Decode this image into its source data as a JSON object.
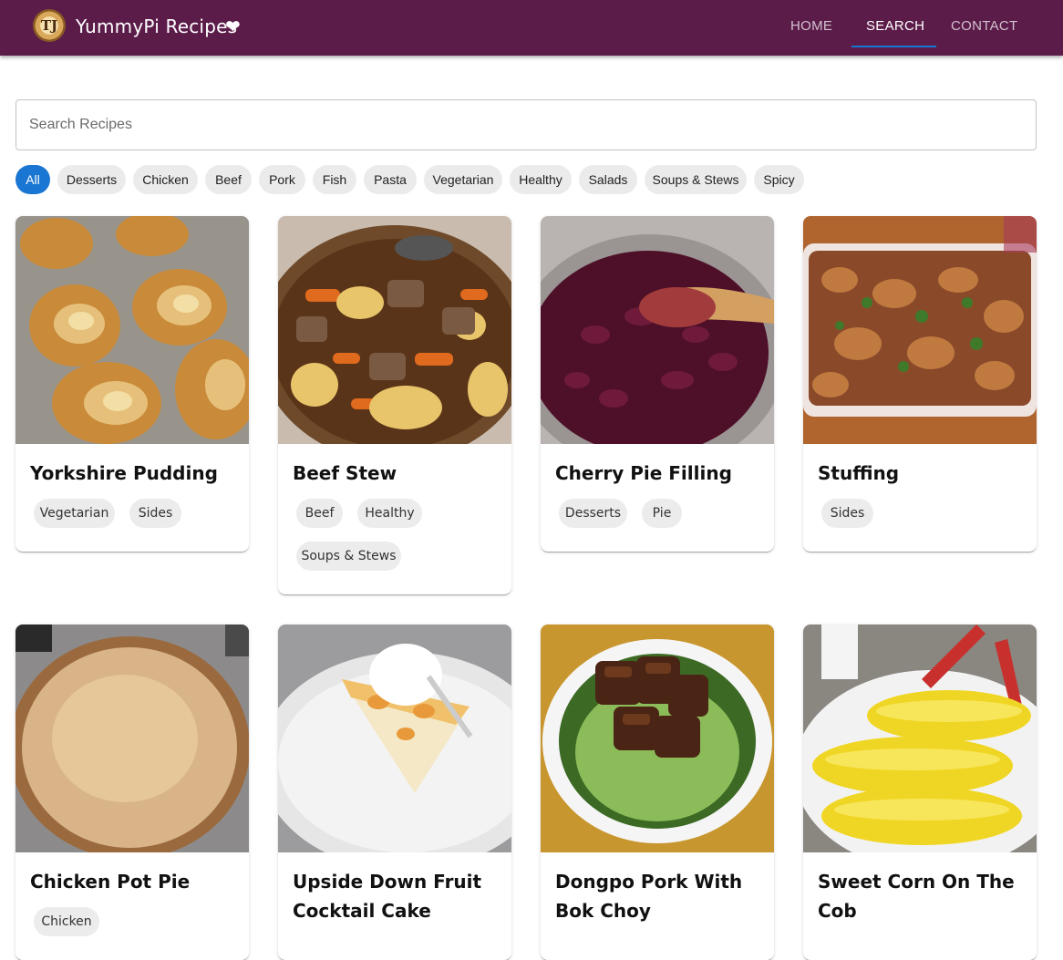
{
  "header": {
    "logo_text": "TJ",
    "title": "YummyPi Recipes",
    "heart": "❤",
    "nav": [
      {
        "label": "HOME"
      },
      {
        "label": "SEARCH",
        "active": true
      },
      {
        "label": "CONTACT"
      }
    ]
  },
  "search": {
    "placeholder": "Search Recipes",
    "value": ""
  },
  "filters": [
    {
      "label": "All",
      "active": true
    },
    {
      "label": "Desserts"
    },
    {
      "label": "Chicken"
    },
    {
      "label": "Beef"
    },
    {
      "label": "Pork"
    },
    {
      "label": "Fish"
    },
    {
      "label": "Pasta"
    },
    {
      "label": "Vegetarian"
    },
    {
      "label": "Healthy"
    },
    {
      "label": "Salads"
    },
    {
      "label": "Soups & Stews"
    },
    {
      "label": "Spicy"
    }
  ],
  "recipes": [
    {
      "title": "Yorkshire Pudding",
      "tags": [
        "Vegetarian",
        "Sides"
      ],
      "image": "yorkshire-pudding-photo"
    },
    {
      "title": "Beef Stew",
      "tags": [
        "Beef",
        "Healthy",
        "Soups & Stews"
      ],
      "image": "beef-stew-photo"
    },
    {
      "title": "Cherry Pie Filling",
      "tags": [
        "Desserts",
        "Pie"
      ],
      "image": "cherry-pie-filling-photo"
    },
    {
      "title": "Stuffing",
      "tags": [
        "Sides"
      ],
      "image": "stuffing-photo"
    },
    {
      "title": "Chicken Pot Pie",
      "tags": [
        "Chicken"
      ],
      "image": "chicken-pot-pie-photo"
    },
    {
      "title": "Upside Down Fruit Cocktail Cake",
      "tags": [],
      "image": "fruit-cocktail-cake-photo"
    },
    {
      "title": "Dongpo Pork With Bok Choy",
      "tags": [],
      "image": "dongpo-pork-photo"
    },
    {
      "title": "Sweet Corn On The Cob",
      "tags": [],
      "image": "sweet-corn-photo"
    }
  ],
  "colors": {
    "appbar": "#5c1c4a",
    "accent": "#1976d2",
    "chip": "#ebebeb"
  }
}
